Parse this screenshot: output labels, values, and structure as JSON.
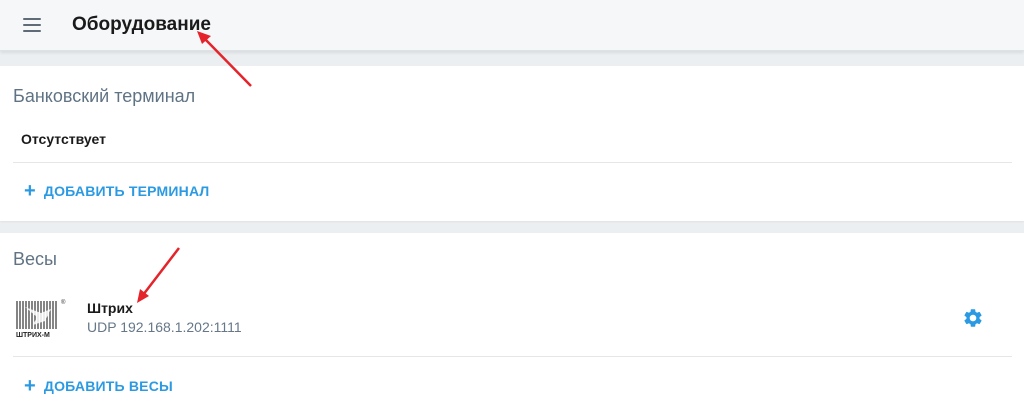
{
  "header": {
    "menu_icon": "hamburger-menu-icon",
    "title": "Оборудование"
  },
  "bank_terminal": {
    "title": "Банковский терминал",
    "status": "Отсутствует",
    "add_label": "ДОБАВИТЬ ТЕРМИНАЛ"
  },
  "scales": {
    "title": "Весы",
    "device": {
      "name": "Штрих",
      "address": "UDP 192.168.1.202:1111",
      "logo_text": "ШТРИХ-М",
      "logo_mark": "®",
      "settings_icon": "gear-icon"
    },
    "add_label": "ДОБАВИТЬ ВЕСЫ"
  },
  "colors": {
    "accent": "#2b9ae2",
    "section_title": "#5f7384",
    "annotation_arrow": "#e5232a"
  }
}
